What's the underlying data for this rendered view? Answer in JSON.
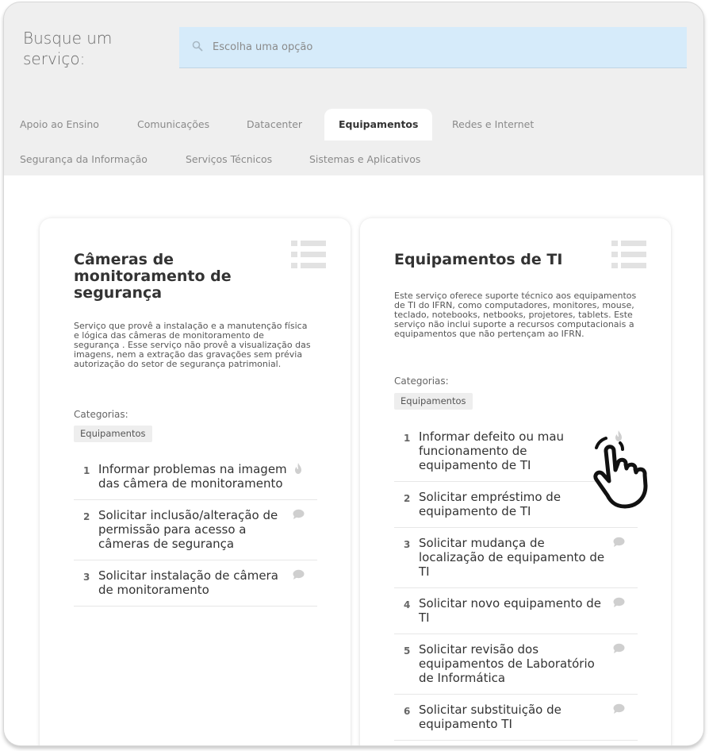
{
  "search": {
    "label": "Busque um serviço:",
    "placeholder": "Escolha uma opção"
  },
  "tabs": [
    {
      "label": "Apoio ao Ensino"
    },
    {
      "label": "Comunicações"
    },
    {
      "label": "Datacenter"
    },
    {
      "label": "Equipamentos",
      "active": true
    },
    {
      "label": "Redes e Internet"
    },
    {
      "label": "Segurança da Informação"
    },
    {
      "label": "Serviços Técnicos"
    },
    {
      "label": "Sistemas e Aplicativos"
    }
  ],
  "cards": [
    {
      "title": "Câmeras de monitoramento de segurança",
      "description": "Serviço que provê a instalação e a manutenção física e lógica das câmeras de monitoramento de segurança . Esse serviço não provê a visualização das imagens, nem a extração das gravações sem prévia autorização do setor de segurança patrimonial.",
      "categories_label": "Categorias:",
      "category": "Equipamentos",
      "services": [
        {
          "num": "1",
          "label": "Informar problemas na imagem das câmera de monitoramento",
          "icon": "fire-icon"
        },
        {
          "num": "2",
          "label": "Solicitar inclusão/alteração de permissão para acesso a câmeras de segurança",
          "icon": "chat-bubble-icon"
        },
        {
          "num": "3",
          "label": "Solicitar instalação de câmera de monitoramento",
          "icon": "chat-bubble-icon"
        }
      ]
    },
    {
      "title": "Equipamentos de TI",
      "description": "Este serviço oferece suporte técnico aos equipamentos de TI do IFRN, como computadores, monitores, mouse, teclado, notebooks, netbooks, projetores, tablets. Este serviço não inclui suporte a recursos computacionais a equipamentos que não pertençam ao IFRN.",
      "categories_label": "Categorias:",
      "category": "Equipamentos",
      "services": [
        {
          "num": "1",
          "label": "Informar defeito ou mau funcionamento de equipamento de TI",
          "icon": "fire-icon"
        },
        {
          "num": "2",
          "label": "Solicitar empréstimo de equipamento de TI",
          "icon": "chat-bubble-icon"
        },
        {
          "num": "3",
          "label": "Solicitar mudança de localização de equipamento de TI",
          "icon": "chat-bubble-icon"
        },
        {
          "num": "4",
          "label": "Solicitar novo equipamento de TI",
          "icon": "chat-bubble-icon"
        },
        {
          "num": "5",
          "label": "Solicitar revisão dos equipamentos de Laboratório de Informática",
          "icon": "chat-bubble-icon"
        },
        {
          "num": "6",
          "label": "Solicitar substituição de equipamento TI",
          "icon": "chat-bubble-icon"
        }
      ]
    }
  ],
  "colors": {
    "search_bg": "#d6ebfa",
    "page_bg": "#efefef",
    "badge_bg": "#eeeeee",
    "icon_gray": "#cfcfcf"
  }
}
